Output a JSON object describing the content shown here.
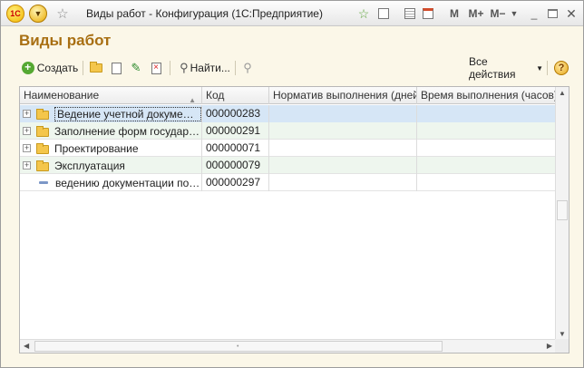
{
  "window": {
    "title": "Виды работ - Конфигурация  (1С:Предприятие)",
    "logo_text": "1С",
    "toolbar_right": {
      "m": "M",
      "mplus": "M+",
      "mminus": "M−"
    }
  },
  "page": {
    "title": "Виды работ"
  },
  "toolbar": {
    "create_label": "Создать",
    "find_label": "Найти...",
    "all_actions_label": "Все действия",
    "help_label": "?"
  },
  "table": {
    "columns": [
      {
        "label": "Наименование"
      },
      {
        "label": "Код"
      },
      {
        "label": "Норматив выполнения (дней)"
      },
      {
        "label": "Время выполнения (часов)"
      }
    ],
    "rows": [
      {
        "type": "group",
        "name": "Ведение учетной документа...",
        "code": "000000283",
        "norm": "",
        "time": "",
        "selected": true
      },
      {
        "type": "group",
        "name": "Заполнение форм государст...",
        "code": "000000291",
        "norm": "",
        "time": "",
        "selected": false
      },
      {
        "type": "group",
        "name": "Проектирование",
        "code": "000000071",
        "norm": "",
        "time": "",
        "selected": false
      },
      {
        "type": "group",
        "name": "Эксплуатация",
        "code": "000000079",
        "norm": "",
        "time": "",
        "selected": false
      },
      {
        "type": "item",
        "name": "ведению документации по о...",
        "code": "000000297",
        "norm": "",
        "time": "",
        "selected": false
      }
    ]
  },
  "icons": {
    "logo": "1c-logo-icon",
    "main_menu": "main-menu-icon",
    "favorite": "star-icon",
    "add_favorite": "add-favorite-icon",
    "create": "plus-icon",
    "create_group": "folder-add-icon",
    "copy": "copy-icon",
    "edit": "pencil-icon",
    "delete": "delete-icon",
    "find": "magnifier-icon",
    "cancel_search": "cancel-search-icon",
    "help": "help-icon"
  },
  "colors": {
    "title": "#a86f12",
    "selection": "#d6e6f6",
    "alt_row": "#eef6ee",
    "form_bg": "#fbf7e8"
  }
}
